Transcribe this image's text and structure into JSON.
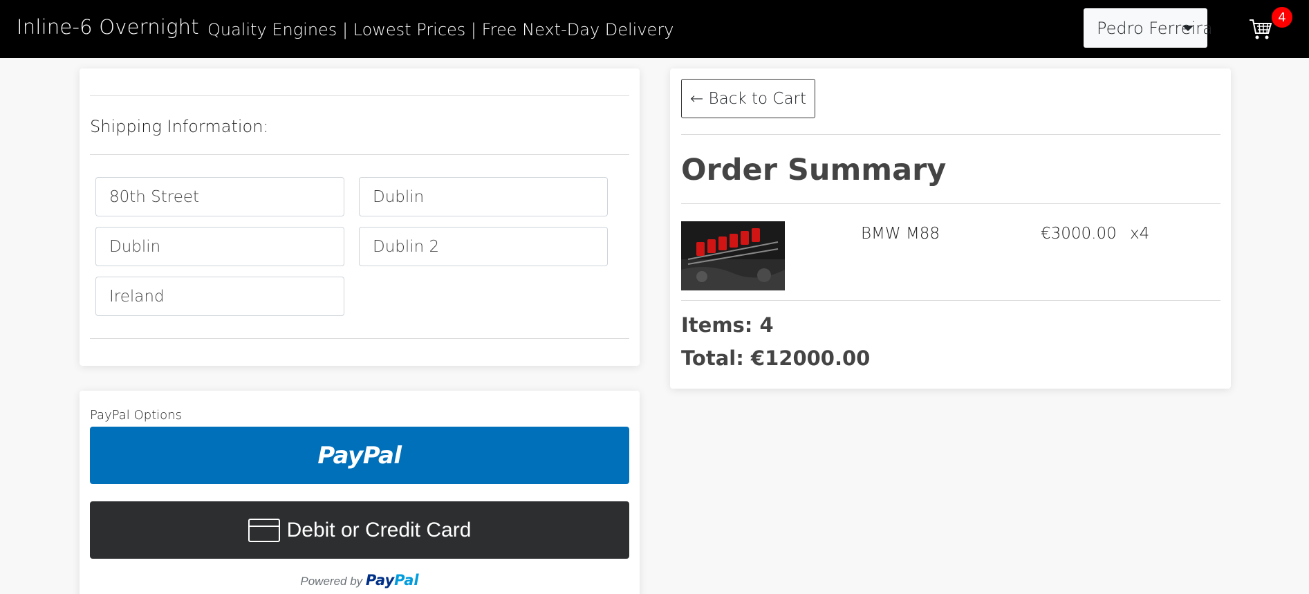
{
  "navbar": {
    "brand": "Inline-6 Overnight",
    "tagline": "Quality Engines | Lowest Prices | Free Next-Day Delivery",
    "user_name": "Pedro Ferreira",
    "cart_count": "4"
  },
  "shipping": {
    "title": "Shipping Information:",
    "fields": [
      {
        "value": "80th Street"
      },
      {
        "value": "Dublin"
      },
      {
        "value": "Dublin"
      },
      {
        "value": "Dublin 2"
      },
      {
        "value": "Ireland"
      }
    ]
  },
  "payment": {
    "options_label": "PayPal Options",
    "paypal_button": "PayPal",
    "card_button": "Debit or Credit Card",
    "powered_by": "Powered by",
    "powered_brand_a": "Pay",
    "powered_brand_b": "Pal"
  },
  "summary": {
    "back_label": "← Back to Cart",
    "title": "Order Summary",
    "item": {
      "name": "BMW M88",
      "price": "€3000.00",
      "quantity": "x4",
      "image": "engine-photo"
    },
    "items_line": "Items: 4",
    "total_line": "Total: €12000.00"
  },
  "colors": {
    "navbar_bg": "#000000",
    "badge": "#ff0000",
    "paypal_blue": "#0070ba",
    "card_button_bg": "#2c2e2f"
  }
}
